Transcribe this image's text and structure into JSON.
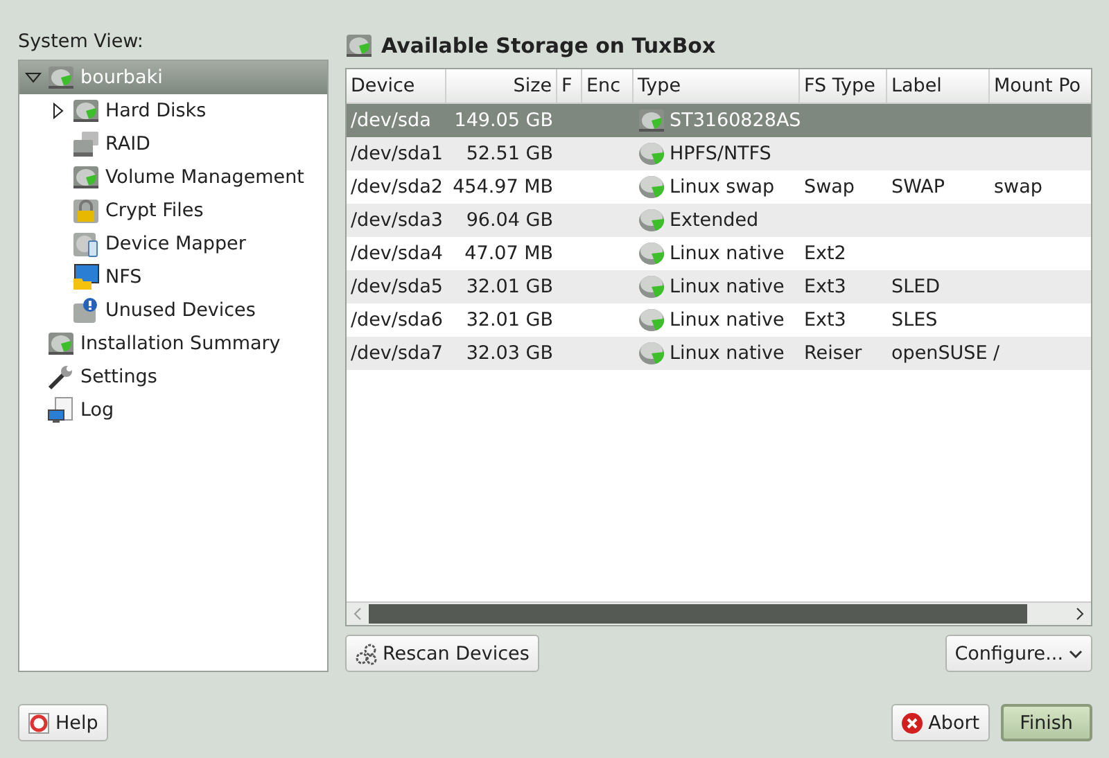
{
  "sidebar": {
    "label": "System View:",
    "tree": [
      {
        "label": "bourbaki",
        "kind": "disk",
        "expanded": true,
        "selected": true,
        "children": [
          {
            "label": "Hard Disks",
            "kind": "disk",
            "expanded": false,
            "selected": false
          },
          {
            "label": "RAID",
            "kind": "raid",
            "selected": false
          },
          {
            "label": "Volume Management",
            "kind": "disk",
            "selected": false
          },
          {
            "label": "Crypt Files",
            "kind": "lock",
            "selected": false
          },
          {
            "label": "Device Mapper",
            "kind": "mapper",
            "selected": false
          },
          {
            "label": "NFS",
            "kind": "nfs",
            "selected": false
          },
          {
            "label": "Unused Devices",
            "kind": "unused",
            "selected": false
          }
        ]
      },
      {
        "label": "Installation Summary",
        "kind": "disk",
        "selected": false
      },
      {
        "label": "Settings",
        "kind": "wrench",
        "selected": false
      },
      {
        "label": "Log",
        "kind": "log",
        "selected": false
      }
    ]
  },
  "main": {
    "title": "Available Storage on TuxBox",
    "table": {
      "columns": [
        "Device",
        "Size",
        "F",
        "Enc",
        "Type",
        "FS Type",
        "Label",
        "Mount Po"
      ],
      "rows": [
        {
          "selected": true,
          "kind": "disk",
          "cells": [
            "/dev/sda",
            "149.05 GB",
            "",
            "",
            "ST3160828AS",
            "",
            "",
            ""
          ]
        },
        {
          "selected": false,
          "kind": "partition",
          "cells": [
            "/dev/sda1",
            "52.51 GB",
            "",
            "",
            "HPFS/NTFS",
            "",
            "",
            ""
          ]
        },
        {
          "selected": false,
          "kind": "partition",
          "cells": [
            "/dev/sda2",
            "454.97 MB",
            "",
            "",
            "Linux swap",
            "Swap",
            "SWAP",
            "swap"
          ]
        },
        {
          "selected": false,
          "kind": "partition",
          "cells": [
            "/dev/sda3",
            "96.04 GB",
            "",
            "",
            "Extended",
            "",
            "",
            ""
          ]
        },
        {
          "selected": false,
          "kind": "partition",
          "cells": [
            "/dev/sda4",
            "47.07 MB",
            "",
            "",
            "Linux native",
            "Ext2",
            "",
            ""
          ]
        },
        {
          "selected": false,
          "kind": "partition",
          "cells": [
            "/dev/sda5",
            "32.01 GB",
            "",
            "",
            "Linux native",
            "Ext3",
            "SLED",
            ""
          ]
        },
        {
          "selected": false,
          "kind": "partition",
          "cells": [
            "/dev/sda6",
            "32.01 GB",
            "",
            "",
            "Linux native",
            "Ext3",
            "SLES",
            ""
          ]
        },
        {
          "selected": false,
          "kind": "partition",
          "cells": [
            "/dev/sda7",
            "32.03 GB",
            "",
            "",
            "Linux native",
            "Reiser",
            "openSUSE /",
            ""
          ]
        }
      ]
    },
    "rescan_button": "Rescan Devices",
    "configure_button": "Configure..."
  },
  "footer": {
    "help_button": "Help",
    "abort_button": "Abort",
    "finish_button": "Finish"
  }
}
